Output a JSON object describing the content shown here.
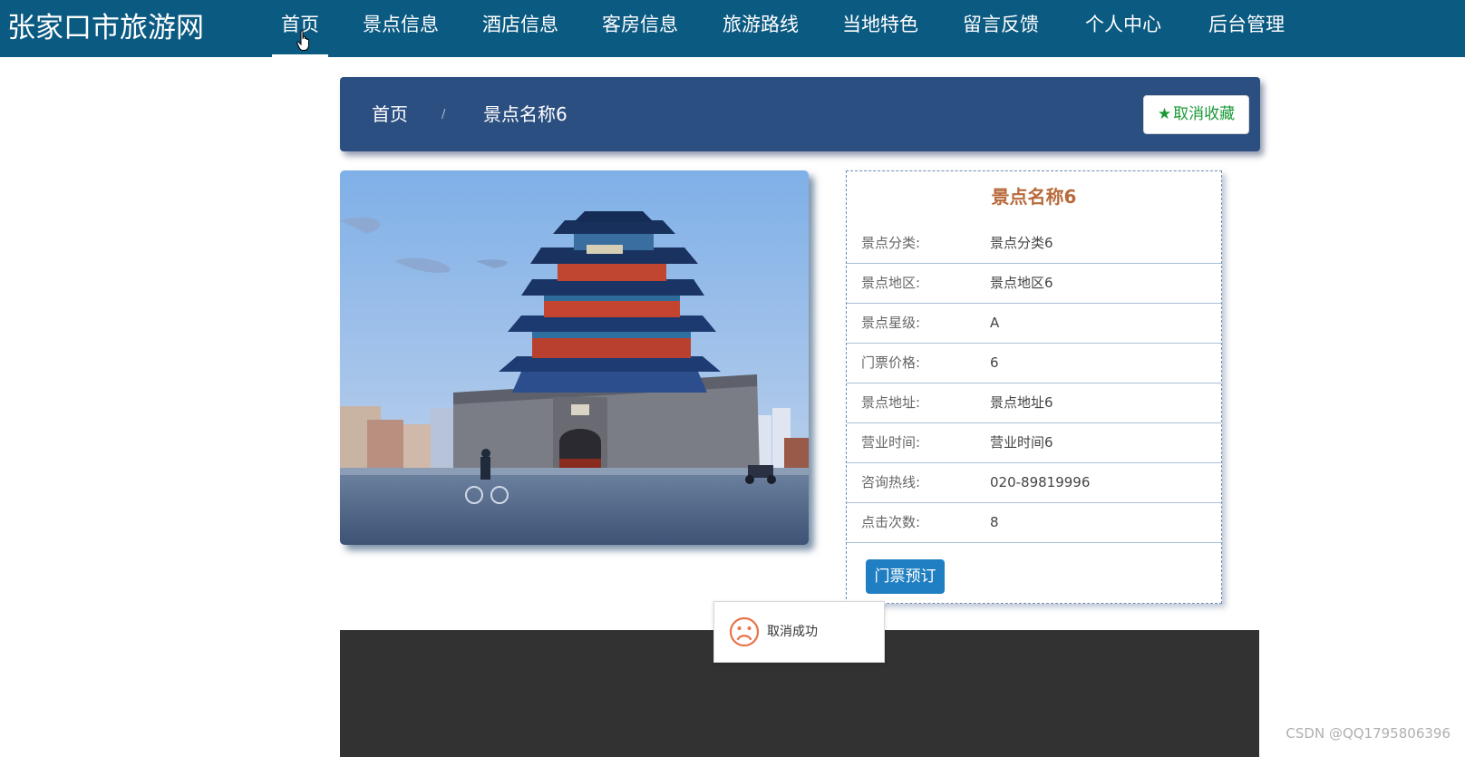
{
  "header": {
    "site_title": "张家口市旅游网",
    "nav": [
      {
        "label": "首页",
        "active": true
      },
      {
        "label": "景点信息"
      },
      {
        "label": "酒店信息"
      },
      {
        "label": "客房信息"
      },
      {
        "label": "旅游路线"
      },
      {
        "label": "当地特色"
      },
      {
        "label": "留言反馈"
      },
      {
        "label": "个人中心"
      },
      {
        "label": "后台管理"
      }
    ]
  },
  "breadcrumb": {
    "home": "首页",
    "separator": "/",
    "current": "景点名称6"
  },
  "favorite_button": {
    "icon": "star-icon",
    "label": "取消收藏"
  },
  "detail": {
    "title": "景点名称6",
    "rows": [
      {
        "label": "景点分类:",
        "value": "景点分类6"
      },
      {
        "label": "景点地区:",
        "value": "景点地区6"
      },
      {
        "label": "景点星级:",
        "value": "A"
      },
      {
        "label": "门票价格:",
        "value": "6"
      },
      {
        "label": "景点地址:",
        "value": "景点地址6"
      },
      {
        "label": "营业时间:",
        "value": "营业时间6"
      },
      {
        "label": "咨询热线:",
        "value": "020-89819996"
      },
      {
        "label": "点击次数:",
        "value": "8"
      }
    ],
    "book_button": "门票预订"
  },
  "toast": {
    "icon": "sad-face-icon",
    "message": "取消成功"
  },
  "watermark": "CSDN @QQ1795806396",
  "colors": {
    "topbar": "#0b5a82",
    "breadcrumb_bg": "#2c4f82",
    "title_accent": "#b86a3c",
    "favorite_green": "#1a9a36",
    "book_button": "#1f7fc2",
    "footer": "#323232"
  }
}
